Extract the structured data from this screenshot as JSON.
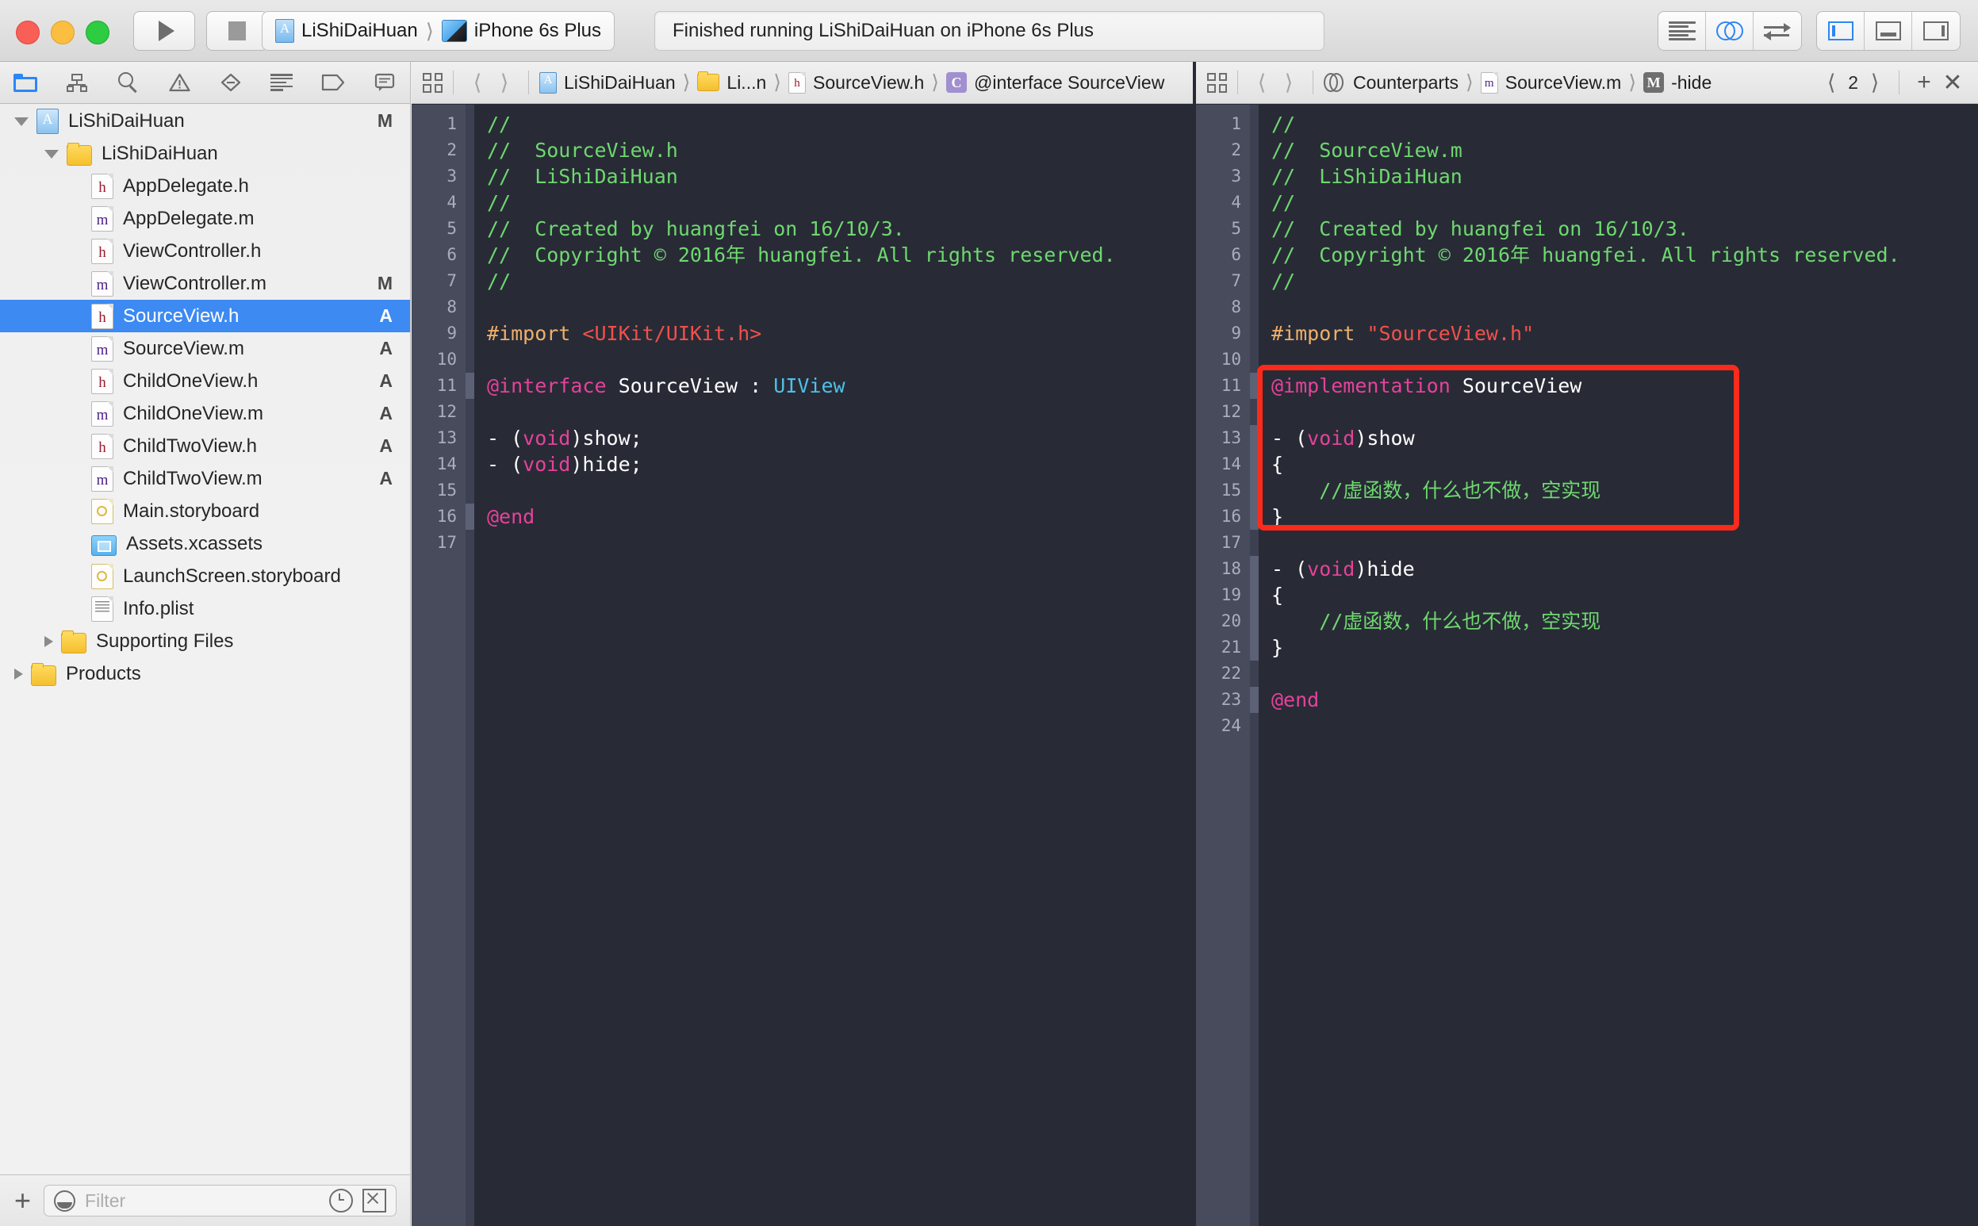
{
  "titlebar": {
    "window_controls": [
      "close",
      "minimize",
      "maximize"
    ],
    "run_button": "run-icon",
    "stop_button": "stop-icon",
    "scheme": {
      "project": "LiShiDaiHuan",
      "destination": "iPhone 6s Plus"
    },
    "status": "Finished running LiShiDaiHuan on iPhone 6s Plus",
    "editor_modes": [
      "standard-editor-icon",
      "assistant-editor-icon",
      "version-editor-icon"
    ],
    "view_toggles": [
      "navigator-panel-icon",
      "debug-panel-icon",
      "utilities-panel-icon"
    ]
  },
  "navigator": {
    "tabs": [
      "project-navigator-icon",
      "symbol-navigator-icon",
      "find-navigator-icon",
      "issue-navigator-icon",
      "test-navigator-icon",
      "report-navigator-icon",
      "debug-navigator-icon",
      "breakpoint-navigator-icon"
    ],
    "tree": [
      {
        "label": "LiShiDaiHuan",
        "status": "M",
        "indent": 0,
        "icon": "xcodeproj",
        "disclosure": "open"
      },
      {
        "label": "LiShiDaiHuan",
        "status": "",
        "indent": 1,
        "icon": "folder",
        "disclosure": "open"
      },
      {
        "label": "AppDelegate.h",
        "status": "",
        "indent": 2,
        "icon": "header",
        "disclosure": "none"
      },
      {
        "label": "AppDelegate.m",
        "status": "",
        "indent": 2,
        "icon": "impl",
        "disclosure": "none"
      },
      {
        "label": "ViewController.h",
        "status": "",
        "indent": 2,
        "icon": "header",
        "disclosure": "none"
      },
      {
        "label": "ViewController.m",
        "status": "M",
        "indent": 2,
        "icon": "impl",
        "disclosure": "none"
      },
      {
        "label": "SourceView.h",
        "status": "A",
        "indent": 2,
        "icon": "header",
        "disclosure": "none",
        "selected": true
      },
      {
        "label": "SourceView.m",
        "status": "A",
        "indent": 2,
        "icon": "impl",
        "disclosure": "none"
      },
      {
        "label": "ChildOneView.h",
        "status": "A",
        "indent": 2,
        "icon": "header",
        "disclosure": "none"
      },
      {
        "label": "ChildOneView.m",
        "status": "A",
        "indent": 2,
        "icon": "impl",
        "disclosure": "none"
      },
      {
        "label": "ChildTwoView.h",
        "status": "A",
        "indent": 2,
        "icon": "header",
        "disclosure": "none"
      },
      {
        "label": "ChildTwoView.m",
        "status": "A",
        "indent": 2,
        "icon": "impl",
        "disclosure": "none"
      },
      {
        "label": "Main.storyboard",
        "status": "",
        "indent": 2,
        "icon": "storyboard",
        "disclosure": "none"
      },
      {
        "label": "Assets.xcassets",
        "status": "",
        "indent": 2,
        "icon": "xcassets",
        "disclosure": "none"
      },
      {
        "label": "LaunchScreen.storyboard",
        "status": "",
        "indent": 2,
        "icon": "storyboard",
        "disclosure": "none"
      },
      {
        "label": "Info.plist",
        "status": "",
        "indent": 2,
        "icon": "plist",
        "disclosure": "none"
      },
      {
        "label": "Supporting Files",
        "status": "",
        "indent": 1,
        "icon": "folder",
        "disclosure": "closed"
      },
      {
        "label": "Products",
        "status": "",
        "indent": 0,
        "icon": "folder",
        "disclosure": "closed"
      }
    ],
    "filter": {
      "placeholder": "Filter",
      "value": ""
    },
    "add_button": "+"
  },
  "editor_left": {
    "jumpbar": {
      "crumbs": [
        "LiShiDaiHuan",
        "Li...n",
        "SourceView.h",
        "@interface SourceView"
      ]
    },
    "line_count": 17,
    "highlighted_lines": [
      11,
      16
    ],
    "lines": [
      [
        {
          "t": "//",
          "c": "comment"
        }
      ],
      [
        {
          "t": "//  SourceView.h",
          "c": "comment"
        }
      ],
      [
        {
          "t": "//  LiShiDaiHuan",
          "c": "comment"
        }
      ],
      [
        {
          "t": "//",
          "c": "comment"
        }
      ],
      [
        {
          "t": "//  Created by huangfei on 16/10/3.",
          "c": "comment"
        }
      ],
      [
        {
          "t": "//  Copyright © 2016年 huangfei. All rights reserved.",
          "c": "comment"
        }
      ],
      [
        {
          "t": "//",
          "c": "comment"
        }
      ],
      [],
      [
        {
          "t": "#import ",
          "c": "pre"
        },
        {
          "t": "<UIKit/UIKit.h>",
          "c": "string"
        }
      ],
      [],
      [
        {
          "t": "@interface",
          "c": "kw"
        },
        {
          "t": " SourceView ",
          "c": "plain"
        },
        {
          "t": ":",
          "c": "plain"
        },
        {
          "t": " ",
          "c": "plain"
        },
        {
          "t": "UIView",
          "c": "type"
        }
      ],
      [],
      [
        {
          "t": "- (",
          "c": "plain"
        },
        {
          "t": "void",
          "c": "kw"
        },
        {
          "t": ")show;",
          "c": "plain"
        }
      ],
      [
        {
          "t": "- (",
          "c": "plain"
        },
        {
          "t": "void",
          "c": "kw"
        },
        {
          "t": ")hide;",
          "c": "plain"
        }
      ],
      [],
      [
        {
          "t": "@end",
          "c": "kw"
        }
      ],
      []
    ]
  },
  "editor_right": {
    "jumpbar": {
      "crumbs": [
        "Counterparts",
        "SourceView.m",
        "-hide"
      ],
      "counter": "2",
      "add_label": "+",
      "close_label": "✕"
    },
    "line_count": 24,
    "highlighted_lines": [
      11,
      13,
      14,
      15,
      16,
      18,
      19,
      20,
      21,
      23
    ],
    "lines": [
      [
        {
          "t": "//",
          "c": "comment"
        }
      ],
      [
        {
          "t": "//  SourceView.m",
          "c": "comment"
        }
      ],
      [
        {
          "t": "//  LiShiDaiHuan",
          "c": "comment"
        }
      ],
      [
        {
          "t": "//",
          "c": "comment"
        }
      ],
      [
        {
          "t": "//  Created by huangfei on 16/10/3.",
          "c": "comment"
        }
      ],
      [
        {
          "t": "//  Copyright © 2016年 huangfei. All rights reserved.",
          "c": "comment"
        }
      ],
      [
        {
          "t": "//",
          "c": "comment"
        }
      ],
      [],
      [
        {
          "t": "#import ",
          "c": "pre"
        },
        {
          "t": "\"SourceView.h\"",
          "c": "string"
        }
      ],
      [],
      [
        {
          "t": "@implementation",
          "c": "kw"
        },
        {
          "t": " SourceView",
          "c": "plain"
        }
      ],
      [],
      [
        {
          "t": "- (",
          "c": "plain"
        },
        {
          "t": "void",
          "c": "kw"
        },
        {
          "t": ")show",
          "c": "plain"
        }
      ],
      [
        {
          "t": "{",
          "c": "plain"
        }
      ],
      [
        {
          "t": "    //虚函数，什么也不做，空实现",
          "c": "comment"
        }
      ],
      [
        {
          "t": "}",
          "c": "plain"
        }
      ],
      [],
      [
        {
          "t": "- (",
          "c": "plain"
        },
        {
          "t": "void",
          "c": "kw"
        },
        {
          "t": ")hide",
          "c": "plain"
        }
      ],
      [
        {
          "t": "{",
          "c": "plain"
        }
      ],
      [
        {
          "t": "    //虚函数，什么也不做，空实现",
          "c": "comment"
        }
      ],
      [
        {
          "t": "}",
          "c": "plain"
        }
      ],
      [],
      [
        {
          "t": "@end",
          "c": "kw"
        }
      ],
      []
    ]
  },
  "annotation": {
    "shape": "rectangle",
    "color": "#fb2b1b",
    "covers_lines": "13-21"
  },
  "colors": {
    "editor_background": "#282b36",
    "gutter_background": "#474b5c",
    "selection_blue": "#3c8af2",
    "accent_blue": "#2d86f5",
    "comment_green": "#6fd86f",
    "keyword_pink": "#e5429a",
    "string_red": "#f2504b",
    "preprocessor_orange": "#eeb06a",
    "type_cyan": "#4fc0e8",
    "annotation_red": "#fb2b1b"
  }
}
